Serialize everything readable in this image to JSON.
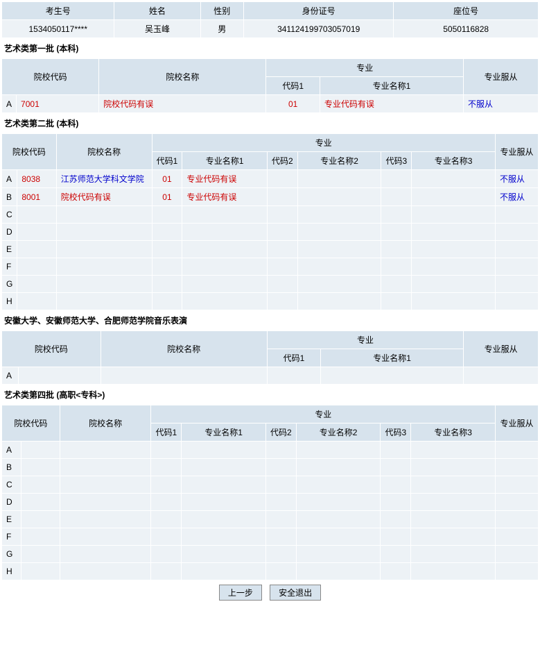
{
  "student": {
    "h_examno": "考生号",
    "h_name": "姓名",
    "h_gender": "性别",
    "h_idno": "身份证号",
    "h_seat": "座位号",
    "v_examno": "1534050117****",
    "v_name": "吴玉峰",
    "v_gender": "男",
    "v_idno": "341124199703057019",
    "v_seat": "5050116828"
  },
  "section1": {
    "title": "艺术类第一批 (本科)",
    "cols": {
      "schcode": "院校代码",
      "schname": "院校名称",
      "major_group": "专业",
      "code1": "代码1",
      "name1": "专业名称1",
      "obey": "专业服从"
    },
    "rows": [
      {
        "idx": "A",
        "schcode": "7001",
        "schname": "院校代码有误",
        "code1": "01",
        "name1": "专业代码有误",
        "obey": "不服从"
      }
    ]
  },
  "section2": {
    "title": "艺术类第二批 (本科)",
    "cols": {
      "schcode": "院校代码",
      "schname": "院校名称",
      "major_group": "专业",
      "code1": "代码1",
      "name1": "专业名称1",
      "code2": "代码2",
      "name2": "专业名称2",
      "code3": "代码3",
      "name3": "专业名称3",
      "obey": "专业服从"
    },
    "rows": [
      {
        "idx": "A",
        "schcode": "8038",
        "schname": "江苏师范大学科文学院",
        "code1": "01",
        "name1": "专业代码有误",
        "code2": "",
        "name2": "",
        "code3": "",
        "name3": "",
        "obey": "不服从"
      },
      {
        "idx": "B",
        "schcode": "8001",
        "schname": "院校代码有误",
        "code1": "01",
        "name1": "专业代码有误",
        "code2": "",
        "name2": "",
        "code3": "",
        "name3": "",
        "obey": "不服从"
      },
      {
        "idx": "C",
        "schcode": "",
        "schname": "",
        "code1": "",
        "name1": "",
        "code2": "",
        "name2": "",
        "code3": "",
        "name3": "",
        "obey": ""
      },
      {
        "idx": "D",
        "schcode": "",
        "schname": "",
        "code1": "",
        "name1": "",
        "code2": "",
        "name2": "",
        "code3": "",
        "name3": "",
        "obey": ""
      },
      {
        "idx": "E",
        "schcode": "",
        "schname": "",
        "code1": "",
        "name1": "",
        "code2": "",
        "name2": "",
        "code3": "",
        "name3": "",
        "obey": ""
      },
      {
        "idx": "F",
        "schcode": "",
        "schname": "",
        "code1": "",
        "name1": "",
        "code2": "",
        "name2": "",
        "code3": "",
        "name3": "",
        "obey": ""
      },
      {
        "idx": "G",
        "schcode": "",
        "schname": "",
        "code1": "",
        "name1": "",
        "code2": "",
        "name2": "",
        "code3": "",
        "name3": "",
        "obey": ""
      },
      {
        "idx": "H",
        "schcode": "",
        "schname": "",
        "code1": "",
        "name1": "",
        "code2": "",
        "name2": "",
        "code3": "",
        "name3": "",
        "obey": ""
      }
    ]
  },
  "section3": {
    "title": "安徽大学、安徽师范大学、合肥师范学院音乐表演",
    "cols": {
      "schcode": "院校代码",
      "schname": "院校名称",
      "major_group": "专业",
      "code1": "代码1",
      "name1": "专业名称1",
      "obey": "专业服从"
    },
    "rows": [
      {
        "idx": "A",
        "schcode": "",
        "schname": "",
        "code1": "",
        "name1": "",
        "obey": ""
      }
    ]
  },
  "section4": {
    "title": "艺术类第四批 (高职<专科>)",
    "cols": {
      "schcode": "院校代码",
      "schname": "院校名称",
      "major_group": "专业",
      "code1": "代码1",
      "name1": "专业名称1",
      "code2": "代码2",
      "name2": "专业名称2",
      "code3": "代码3",
      "name3": "专业名称3",
      "obey": "专业服从"
    },
    "rows": [
      {
        "idx": "A",
        "schcode": "",
        "schname": "",
        "code1": "",
        "name1": "",
        "code2": "",
        "name2": "",
        "code3": "",
        "name3": "",
        "obey": ""
      },
      {
        "idx": "B",
        "schcode": "",
        "schname": "",
        "code1": "",
        "name1": "",
        "code2": "",
        "name2": "",
        "code3": "",
        "name3": "",
        "obey": ""
      },
      {
        "idx": "C",
        "schcode": "",
        "schname": "",
        "code1": "",
        "name1": "",
        "code2": "",
        "name2": "",
        "code3": "",
        "name3": "",
        "obey": ""
      },
      {
        "idx": "D",
        "schcode": "",
        "schname": "",
        "code1": "",
        "name1": "",
        "code2": "",
        "name2": "",
        "code3": "",
        "name3": "",
        "obey": ""
      },
      {
        "idx": "E",
        "schcode": "",
        "schname": "",
        "code1": "",
        "name1": "",
        "code2": "",
        "name2": "",
        "code3": "",
        "name3": "",
        "obey": ""
      },
      {
        "idx": "F",
        "schcode": "",
        "schname": "",
        "code1": "",
        "name1": "",
        "code2": "",
        "name2": "",
        "code3": "",
        "name3": "",
        "obey": ""
      },
      {
        "idx": "G",
        "schcode": "",
        "schname": "",
        "code1": "",
        "name1": "",
        "code2": "",
        "name2": "",
        "code3": "",
        "name3": "",
        "obey": ""
      },
      {
        "idx": "H",
        "schcode": "",
        "schname": "",
        "code1": "",
        "name1": "",
        "code2": "",
        "name2": "",
        "code3": "",
        "name3": "",
        "obey": ""
      }
    ]
  },
  "buttons": {
    "prev": "上一步",
    "exit": "安全退出"
  }
}
